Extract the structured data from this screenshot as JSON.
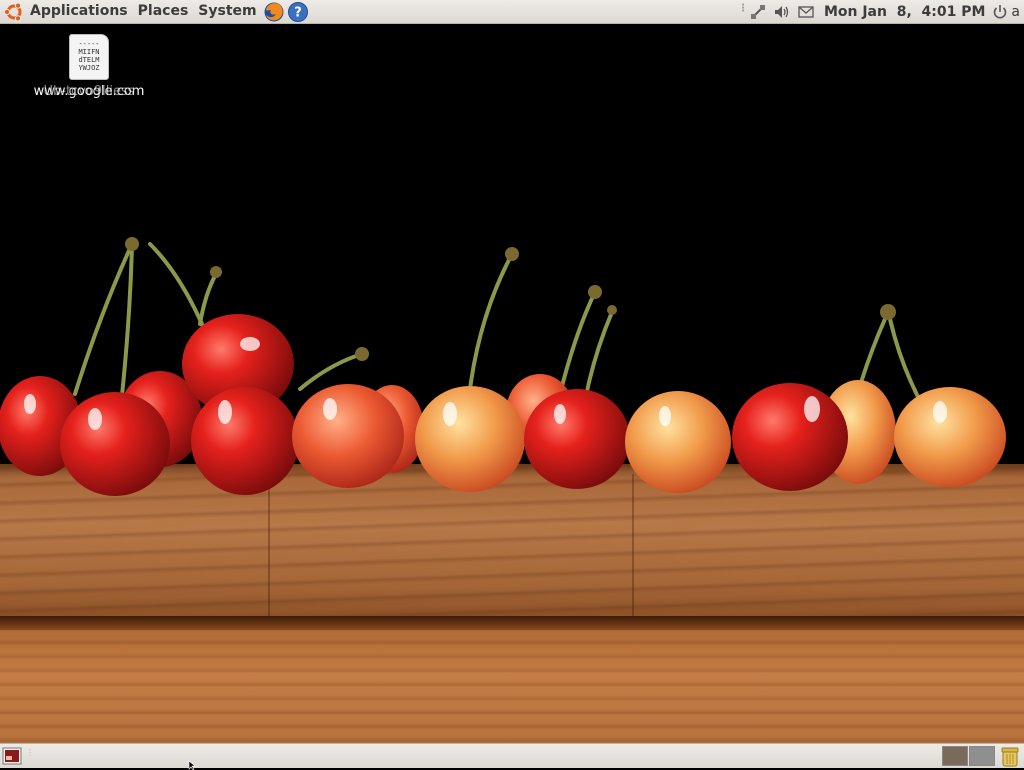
{
  "top_panel": {
    "menus": {
      "applications": "Applications",
      "places": "Places",
      "system": "System"
    },
    "clock": "Mon Jan  8,  4:01 PM",
    "user": "a"
  },
  "desktop": {
    "icon": {
      "label": "www.google.com",
      "overlay_label": "Ub-tcvo9lliess",
      "preview_lines": [
        "-----",
        "MIIFN",
        "dTELM",
        "YWJOZ"
      ]
    }
  },
  "colors": {
    "panel": "#dcd8d2",
    "cherry": "#d61a1a",
    "wood": "#b87949"
  }
}
